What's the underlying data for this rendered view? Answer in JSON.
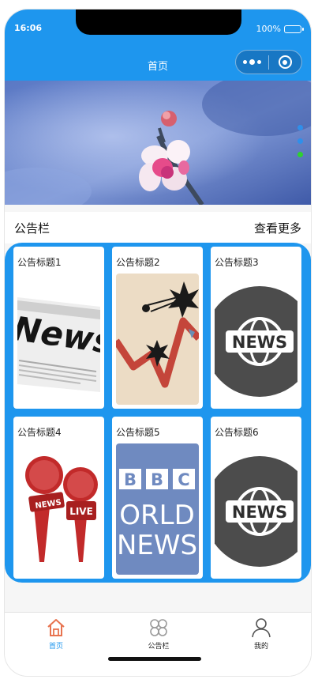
{
  "status_bar": {
    "time": "16:06",
    "battery": "100%"
  },
  "navbar": {
    "title": "首页"
  },
  "banner": {
    "slide_count": 3,
    "active_slide": 3
  },
  "section": {
    "title": "公告栏",
    "more_label": "查看更多"
  },
  "cards": [
    {
      "title": "公告标题1",
      "image": "newspaper-image"
    },
    {
      "title": "公告标题2",
      "image": "chart-explosion-image"
    },
    {
      "title": "公告标题3",
      "image": "news-globe-image"
    },
    {
      "title": "公告标题4",
      "image": "news-microphone-image"
    },
    {
      "title": "公告标题5",
      "image": "bbc-world-news-image"
    },
    {
      "title": "公告标题6",
      "image": "news-globe-image"
    }
  ],
  "tabbar": {
    "items": [
      {
        "label": "首页",
        "icon": "home-icon",
        "active": true
      },
      {
        "label": "公告栏",
        "icon": "grid-icon",
        "active": false
      },
      {
        "label": "我的",
        "icon": "person-icon",
        "active": false
      }
    ]
  },
  "colors": {
    "brand": "#1e96ee",
    "active_tab": "#1e96ee",
    "home_icon": "#e8734f",
    "indicator_active": "#2ed12e"
  }
}
